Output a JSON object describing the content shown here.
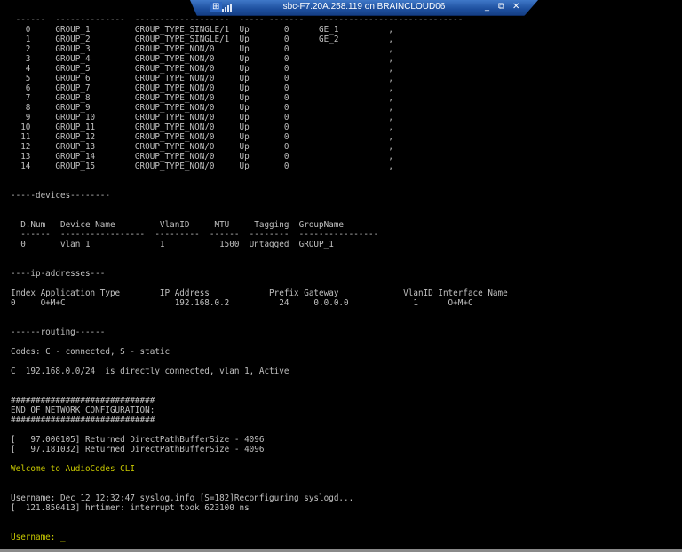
{
  "window": {
    "title": "sbc-F7.20A.258.119 on BRAINCLOUD06",
    "pin_icon": "⊞",
    "minimize_icon": "_",
    "restore_icon": "⧉",
    "close_icon": "✕"
  },
  "colors": {
    "text": "#c0c0c0",
    "highlight": "#c8c800",
    "titlebar": "#1d4f9e"
  },
  "terminal": {
    "lines": [
      {
        "text": " ------  --------------  -------------------  ----- -------   -----------------------------"
      },
      {
        "text": "   0     GROUP_1         GROUP_TYPE_SINGLE/1  Up       0      GE_1          ,"
      },
      {
        "text": "   1     GROUP_2         GROUP_TYPE_SINGLE/1  Up       0      GE_2          ,"
      },
      {
        "text": "   2     GROUP_3         GROUP_TYPE_NON/0     Up       0                    ,"
      },
      {
        "text": "   3     GROUP_4         GROUP_TYPE_NON/0     Up       0                    ,"
      },
      {
        "text": "   4     GROUP_5         GROUP_TYPE_NON/0     Up       0                    ,"
      },
      {
        "text": "   5     GROUP_6         GROUP_TYPE_NON/0     Up       0                    ,"
      },
      {
        "text": "   6     GROUP_7         GROUP_TYPE_NON/0     Up       0                    ,"
      },
      {
        "text": "   7     GROUP_8         GROUP_TYPE_NON/0     Up       0                    ,"
      },
      {
        "text": "   8     GROUP_9         GROUP_TYPE_NON/0     Up       0                    ,"
      },
      {
        "text": "   9     GROUP_10        GROUP_TYPE_NON/0     Up       0                    ,"
      },
      {
        "text": "  10     GROUP_11        GROUP_TYPE_NON/0     Up       0                    ,"
      },
      {
        "text": "  11     GROUP_12        GROUP_TYPE_NON/0     Up       0                    ,"
      },
      {
        "text": "  12     GROUP_13        GROUP_TYPE_NON/0     Up       0                    ,"
      },
      {
        "text": "  13     GROUP_14        GROUP_TYPE_NON/0     Up       0                    ,"
      },
      {
        "text": "  14     GROUP_15        GROUP_TYPE_NON/0     Up       0                    ,"
      },
      {
        "text": ""
      },
      {
        "text": ""
      },
      {
        "text": "-----devices--------"
      },
      {
        "text": ""
      },
      {
        "text": ""
      },
      {
        "text": "  D.Num   Device Name         VlanID     MTU     Tagging  GroupName"
      },
      {
        "text": "  ------  -----------------  ---------  ------  --------  ----------------"
      },
      {
        "text": "  0       vlan 1              1           1500  Untagged  GROUP_1"
      },
      {
        "text": ""
      },
      {
        "text": ""
      },
      {
        "text": "----ip-addresses---"
      },
      {
        "text": ""
      },
      {
        "text": "Index Application Type        IP Address            Prefix Gateway             VlanID Interface Name"
      },
      {
        "text": "0     O+M+C                      192.168.0.2          24     0.0.0.0             1      O+M+C"
      },
      {
        "text": ""
      },
      {
        "text": ""
      },
      {
        "text": "------routing------"
      },
      {
        "text": ""
      },
      {
        "text": "Codes: C - connected, S - static"
      },
      {
        "text": ""
      },
      {
        "text": "C  192.168.0.0/24  is directly connected, vlan 1, Active"
      },
      {
        "text": ""
      },
      {
        "text": ""
      },
      {
        "text": "#############################"
      },
      {
        "text": "END OF NETWORK CONFIGURATION:"
      },
      {
        "text": "#############################"
      },
      {
        "text": ""
      },
      {
        "text": "[   97.000105] Returned DirectPathBufferSize - 4096"
      },
      {
        "text": "[   97.181032] Returned DirectPathBufferSize - 4096"
      },
      {
        "text": ""
      },
      {
        "text": "Welcome to AudioCodes CLI",
        "highlight": true
      },
      {
        "text": ""
      },
      {
        "text": ""
      },
      {
        "text": "Username: Dec 12 12:32:47 syslog.info [S=182]Reconfiguring syslogd..."
      },
      {
        "text": "[  121.850413] hrtimer: interrupt took 623100 ns"
      },
      {
        "text": ""
      },
      {
        "text": ""
      },
      {
        "text": "Username: _",
        "highlight": true
      }
    ]
  }
}
